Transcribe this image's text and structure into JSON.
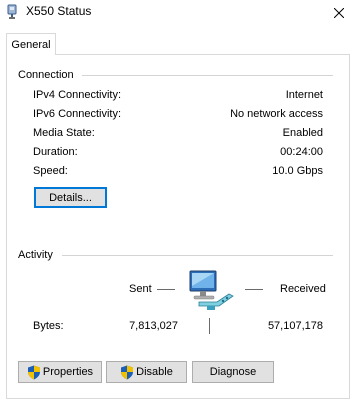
{
  "window": {
    "title": "X550 Status"
  },
  "tabs": [
    {
      "label": "General"
    }
  ],
  "connection": {
    "heading": "Connection",
    "rows": [
      {
        "label": "IPv4 Connectivity:",
        "value": "Internet"
      },
      {
        "label": "IPv6 Connectivity:",
        "value": "No network access"
      },
      {
        "label": "Media State:",
        "value": "Enabled"
      },
      {
        "label": "Duration:",
        "value": "00:24:00"
      },
      {
        "label": "Speed:",
        "value": "10.0 Gbps"
      }
    ],
    "details_label": "Details..."
  },
  "activity": {
    "heading": "Activity",
    "sent_label": "Sent",
    "received_label": "Received",
    "bytes_label": "Bytes:",
    "bytes_sent": "7,813,027",
    "bytes_received": "57,107,178"
  },
  "buttons": {
    "properties": "Properties",
    "disable": "Disable",
    "diagnose": "Diagnose"
  },
  "icons": {
    "app": "network-adapter-icon",
    "close": "close-icon",
    "activity": "network-computer-icon",
    "shield": "uac-shield-icon"
  },
  "colors": {
    "accent": "#0078d7",
    "button_bg": "#e1e1e1",
    "button_border": "#adadad",
    "divider": "#d4d4d4"
  }
}
